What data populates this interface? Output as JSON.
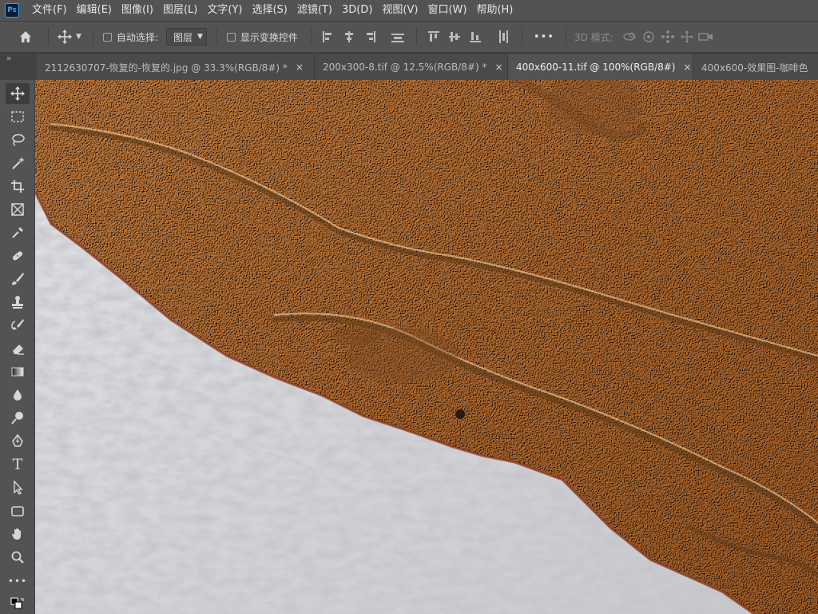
{
  "app": {
    "logo": "Ps"
  },
  "menu": [
    {
      "label": "文件(F)"
    },
    {
      "label": "编辑(E)"
    },
    {
      "label": "图像(I)"
    },
    {
      "label": "图层(L)"
    },
    {
      "label": "文字(Y)"
    },
    {
      "label": "选择(S)"
    },
    {
      "label": "滤镜(T)"
    },
    {
      "label": "3D(D)"
    },
    {
      "label": "视图(V)"
    },
    {
      "label": "窗口(W)"
    },
    {
      "label": "帮助(H)"
    }
  ],
  "options": {
    "auto_select_label": "自动选择:",
    "auto_select_value": "图层",
    "show_transform_label": "显示变换控件",
    "more": "•••",
    "mode3d_label": "3D 模式:"
  },
  "tabs": [
    {
      "label": "2112630707-恢复的-恢复的.jpg @ 33.3%(RGB/8#) *",
      "close": "×"
    },
    {
      "label": "200x300-8.tif @ 12.5%(RGB/8#) *",
      "close": "×"
    },
    {
      "label": "400x600-11.tif @ 100%(RGB/8#)",
      "close": "×"
    },
    {
      "label": "400x600-效果图-咖啡色"
    }
  ],
  "tab_collapse": "»",
  "toolbox": {
    "type_tool": "T",
    "more_tools": "•••"
  },
  "colors": {
    "ui_bg": "#535353",
    "tab_bg": "#424242",
    "accent": "#31a8ff",
    "stone": "#c99a6a",
    "snow": "#cfd0d4"
  }
}
